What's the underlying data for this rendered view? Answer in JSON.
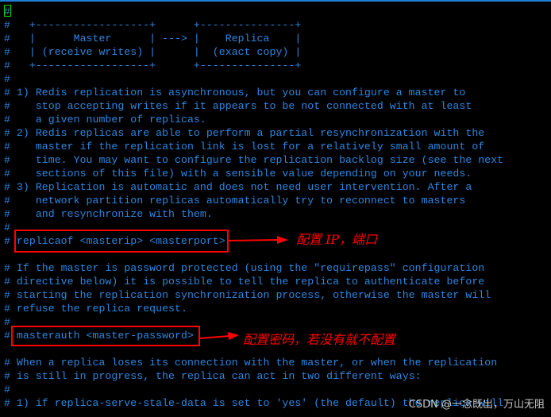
{
  "terminal": {
    "lines": [
      "#",
      "#   +------------------+      +---------------+",
      "#   |      Master      | ---> |    Replica    |",
      "#   | (receive writes) |      |  (exact copy) |",
      "#   +------------------+      +---------------+",
      "#",
      "# 1) Redis replication is asynchronous, but you can configure a master to",
      "#    stop accepting writes if it appears to be not connected with at least",
      "#    a given number of replicas.",
      "# 2) Redis replicas are able to perform a partial resynchronization with the",
      "#    master if the replication link is lost for a relatively small amount of",
      "#    time. You may want to configure the replication backlog size (see the next",
      "#    sections of this file) with a sensible value depending on your needs.",
      "# 3) Replication is automatic and does not need user intervention. After a",
      "#    network partition replicas automatically try to reconnect to masters",
      "#    and resynchronize with them.",
      "#",
      "# replicaof <masterip> <masterport>",
      "",
      "# If the master is password protected (using the \"requirepass\" configuration",
      "# directive below) it is possible to tell the replica to authenticate before",
      "# starting the replication synchronization process, otherwise the master will",
      "# refuse the replica request.",
      "#",
      "# masterauth <master-password>",
      "",
      "# When a replica loses its connection with the master, or when the replication",
      "# is still in progress, the replica can act in two different ways:",
      "#",
      "# 1) if replica-serve-stale-data is set to 'yes' (the default) the replica will"
    ],
    "cursor_char": "#"
  },
  "annotations": {
    "replicaof_note": "配置 IP，端口",
    "masterauth_note": "配置密码，若没有就不配置"
  },
  "watermark": "CSDN @一念既出，万山无阻",
  "colors": {
    "text": "#2b87e3",
    "annotation": "#ff0000",
    "cursor": "#00d800",
    "background": "#000000"
  }
}
